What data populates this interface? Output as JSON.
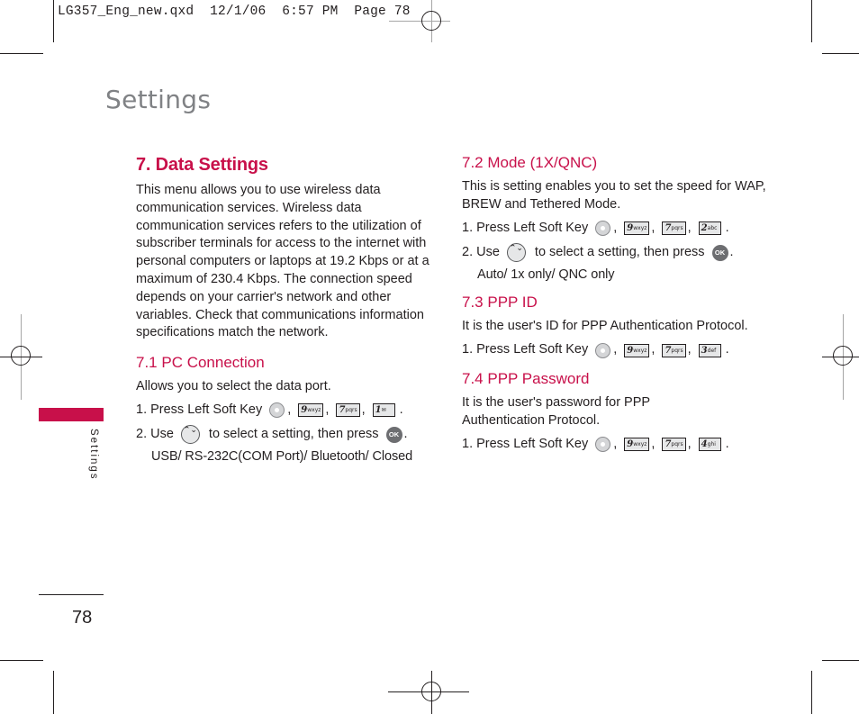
{
  "slug": {
    "text": "LG357_Eng_new.qxd  12/1/06  6:57 PM  Page 78"
  },
  "header": {
    "title": "Settings"
  },
  "side_tab": {
    "label": "Settings",
    "color": "#c8104a"
  },
  "footer": {
    "page_number": "78"
  },
  "accent_color": "#c8104a",
  "icons": {
    "left_soft_key": "left-soft-key-icon",
    "navigation": "up-down-navigation-icon",
    "ok": "ok-button-icon",
    "ok_label": "OK",
    "nav_glyph": "⌃⌄",
    "key_9": {
      "digit": "9",
      "letters": "wxyz"
    },
    "key_7": {
      "digit": "7",
      "letters": "pqrs"
    },
    "key_1": {
      "digit": "1",
      "letters": "✉"
    },
    "key_2": {
      "digit": "2",
      "letters": "abc"
    },
    "key_3": {
      "digit": "3",
      "letters": "def"
    },
    "key_4": {
      "digit": "4",
      "letters": "ghi"
    }
  },
  "sections": {
    "data_settings": {
      "heading": "7. Data Settings",
      "body": "This menu allows you to use wireless data communication services. Wireless data communication services refers to the utilization of subscriber terminals for access to the internet with personal computers or laptops at 19.2 Kbps or at a maximum of 230.4 Kbps. The connection speed depends on your carrier's network and other variables. Check that communications information specifications match the network."
    },
    "pc_connection": {
      "heading": "7.1 PC Connection",
      "body": "Allows you to select the data port.",
      "step1": "1. Press Left Soft Key",
      "step2_pre": "2. Use",
      "step2_post": "to select a setting, then press",
      "options": "USB/ RS-232C(COM Port)/ Bluetooth/ Closed"
    },
    "mode": {
      "heading": "7.2 Mode (1X/QNC)",
      "body": "This is setting enables you to set the speed for WAP, BREW and Tethered Mode.",
      "step1": "1. Press Left Soft Key",
      "step2_pre": "2. Use",
      "step2_post": "to select a setting, then press",
      "options": "Auto/ 1x only/ QNC only"
    },
    "ppp_id": {
      "heading": "7.3 PPP ID",
      "body": "It is the user's ID for PPP Authentication Protocol.",
      "step1": "1. Press Left Soft Key"
    },
    "ppp_password": {
      "heading": "7.4 PPP Password",
      "body": "It is the user's password for PPP Authentication Protocol.",
      "step1": "1. Press Left Soft Key"
    }
  },
  "punct": {
    "comma": ",",
    "period": "."
  }
}
